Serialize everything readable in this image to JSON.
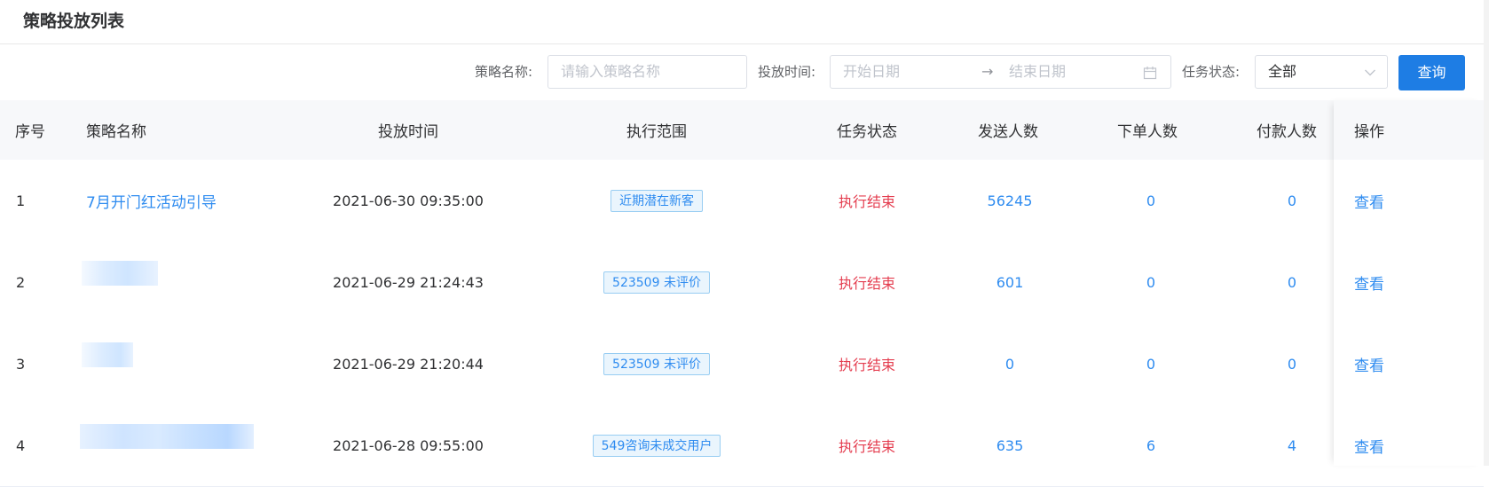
{
  "page": {
    "title": "策略投放列表"
  },
  "filters": {
    "name_label": "策略名称:",
    "name_placeholder": "请输入策略名称",
    "time_label": "投放时间:",
    "start_placeholder": "开始日期",
    "range_separator": "→",
    "end_placeholder": "结束日期",
    "status_label": "任务状态:",
    "status_value": "全部",
    "query_label": "查询"
  },
  "table": {
    "headers": {
      "index": "序号",
      "name": "策略名称",
      "time": "投放时间",
      "scope": "执行范围",
      "status": "任务状态",
      "sent": "发送人数",
      "ordered": "下单人数",
      "paid": "付款人数",
      "action": "操作"
    },
    "rows": [
      {
        "index": "1",
        "name": "7月开门红活动引导",
        "time": "2021-06-30 09:35:00",
        "scope": "近期潜在新客",
        "status": "执行结束",
        "sent": "56245",
        "ordered": "0",
        "paid": "0",
        "action": "查看"
      },
      {
        "index": "2",
        "name": "",
        "time": "2021-06-29 21:24:43",
        "scope": "523509 未评价",
        "status": "执行结束",
        "sent": "601",
        "ordered": "0",
        "paid": "0",
        "action": "查看"
      },
      {
        "index": "3",
        "name": "",
        "time": "2021-06-29 21:20:44",
        "scope": "523509 未评价",
        "status": "执行结束",
        "sent": "0",
        "ordered": "0",
        "paid": "0",
        "action": "查看"
      },
      {
        "index": "4",
        "name": "",
        "time": "2021-06-28 09:55:00",
        "scope": "549咨询未成交用户",
        "status": "执行结束",
        "sent": "635",
        "ordered": "6",
        "paid": "4",
        "action": "查看"
      }
    ]
  },
  "colors": {
    "primary": "#1e7de4",
    "link": "#2f8cf0",
    "status_ended": "#e43d4f"
  }
}
